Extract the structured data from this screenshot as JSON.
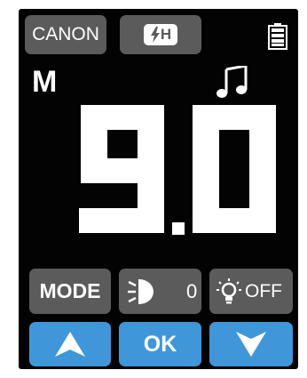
{
  "header": {
    "brand_label": "CANON",
    "flash_mode_label": "H",
    "battery_icon": "battery-full-icon"
  },
  "status": {
    "mode_letter": "M",
    "sound_icon": "music-note-icon"
  },
  "readout": {
    "value": "9.0",
    "integer_part": "9",
    "decimal_part": "0"
  },
  "controls": {
    "mode_label": "MODE",
    "fec_icon": "flash-exposure-compensation-icon",
    "fec_value": "0",
    "light_icon": "assist-light-icon",
    "light_value": "OFF",
    "up_icon": "up-arrow-icon",
    "ok_label": "OK",
    "down_icon": "down-arrow-icon"
  },
  "colors": {
    "screen_background": "#030303",
    "button_gray": "#5b5b5b",
    "button_blue": "#3f97d9",
    "text": "#ffffff"
  }
}
